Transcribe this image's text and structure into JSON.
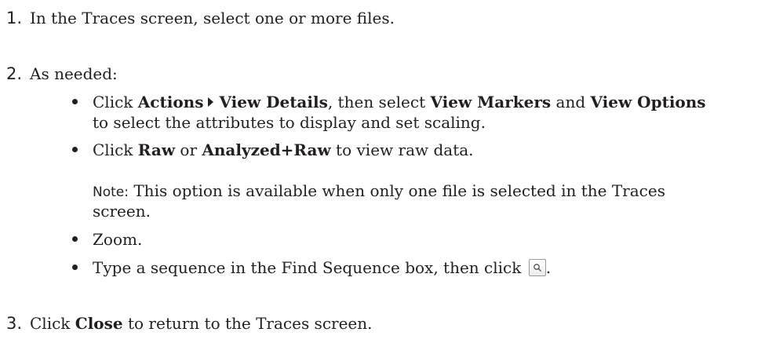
{
  "steps": [
    {
      "number": "1.",
      "text": "In the Traces screen, select one or more files."
    },
    {
      "number": "2.",
      "text": "As needed:",
      "bullets": {
        "view_details": {
          "click": "Click ",
          "actions": "Actions",
          "view_details": "View Details",
          "then_select": ", then select ",
          "view_markers": "View Markers",
          "and": " and ",
          "view_options": "View Options",
          "continuation": "to select the attributes to display and set scaling."
        },
        "raw": {
          "click": "Click ",
          "raw": "Raw",
          "or": " or ",
          "analyzed_raw": "Analyzed+Raw",
          "rest": " to view raw data."
        },
        "note": {
          "label": "Note:",
          "text": " This option is available when only one file is selected in the Traces",
          "continuation": "screen."
        },
        "zoom": {
          "text": "Zoom."
        },
        "find": {
          "text": "Type a sequence in the Find Sequence box, then click ",
          "end": "."
        }
      }
    },
    {
      "number": "3.",
      "click": "Click ",
      "close": "Close",
      "rest": " to return to the Traces screen."
    }
  ],
  "icons": {
    "search_button": "search-icon"
  }
}
